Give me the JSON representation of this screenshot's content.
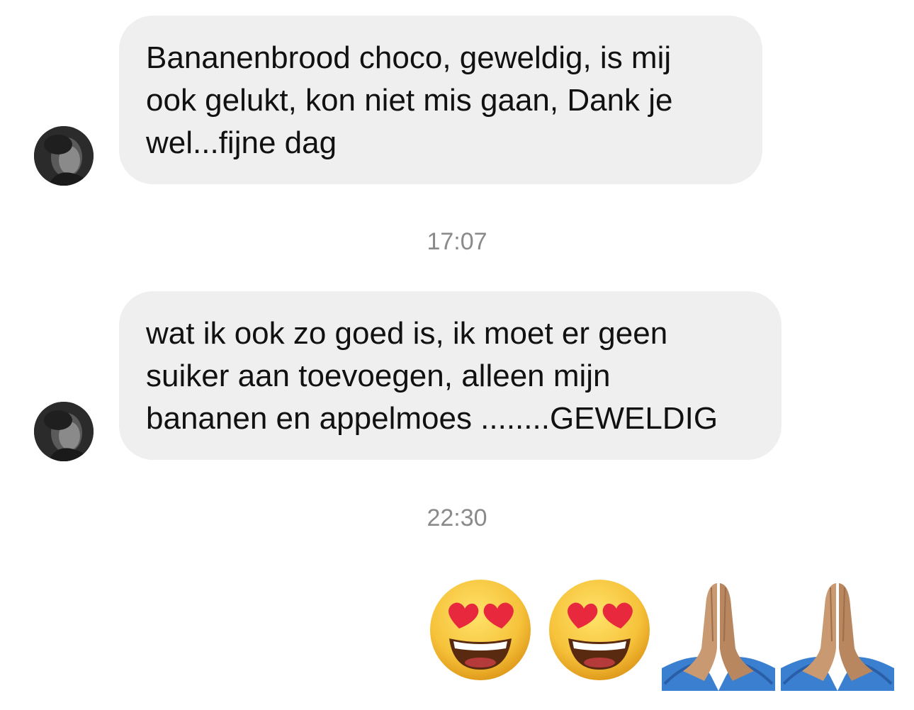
{
  "messages": [
    {
      "sender": "other",
      "text": "Bananenbrood choco, geweldig, is mij\nook gelukt, kon niet mis gaan, Dank je\nwel...fijne dag"
    },
    {
      "sender": "other",
      "text": "wat ik ook zo goed is, ik moet er geen\nsuiker aan toevoegen, alleen mijn\nbananen en appelmoes ........GEWELDIG"
    }
  ],
  "timestamps": [
    "17:07",
    "22:30"
  ],
  "reply": {
    "sender": "me",
    "emojis": [
      "heart-eyes-emoji",
      "heart-eyes-emoji",
      "folded-hands-emoji",
      "folded-hands-emoji"
    ]
  },
  "colors": {
    "bubble_bg": "#efefef",
    "timestamp": "#8a8a8a",
    "emoji_face": "#f6c23a",
    "heart": "#e8283c",
    "sleeve": "#3a7fd0",
    "hand": "#c99a72"
  }
}
